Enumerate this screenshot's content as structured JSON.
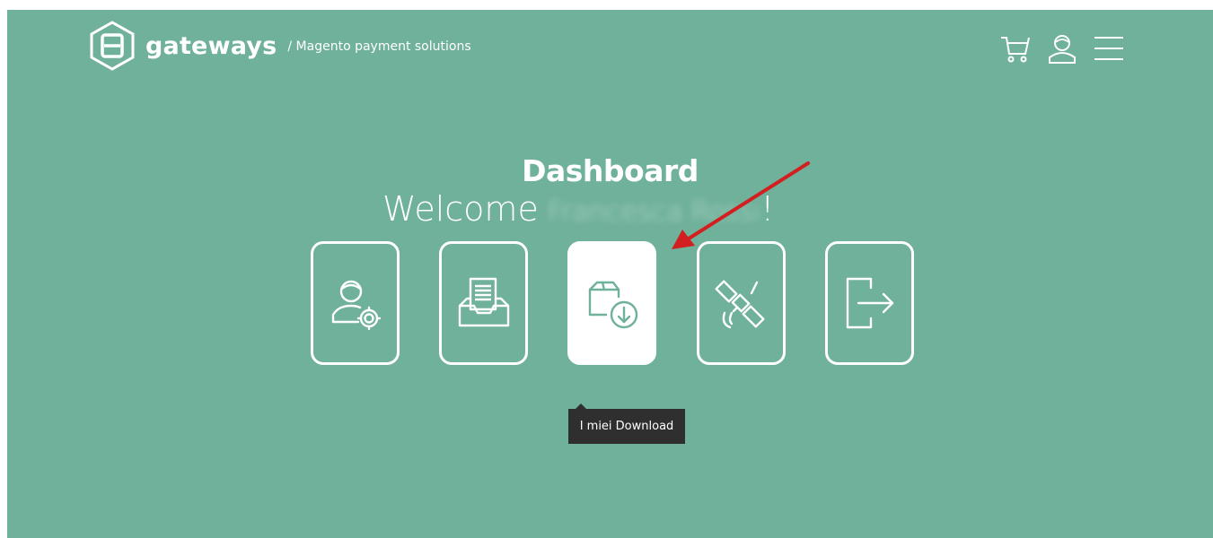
{
  "header": {
    "brand": "gateways",
    "tagline": "/ Magento payment solutions",
    "icons": [
      "cart-icon",
      "user-icon",
      "menu-icon"
    ]
  },
  "main": {
    "title": "Dashboard",
    "welcome_prefix": "Welcome",
    "user_name_blurred": "Francesca Rossi",
    "welcome_suffix": "!",
    "tiles": [
      {
        "icon": "user-settings-icon",
        "active": false
      },
      {
        "icon": "inbox-document-icon",
        "active": false
      },
      {
        "icon": "package-download-icon",
        "active": true
      },
      {
        "icon": "satellite-icon",
        "active": false
      },
      {
        "icon": "logout-icon",
        "active": false
      }
    ],
    "tooltip": "I miei Download"
  },
  "colors": {
    "background": "#6fb19a",
    "tile_border": "#ffffff",
    "tooltip_bg": "#2f2f2f",
    "annotation_arrow": "#d21f1f"
  }
}
